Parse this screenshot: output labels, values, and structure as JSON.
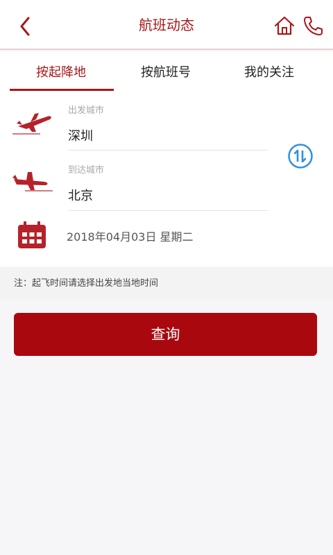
{
  "header": {
    "title": "航班动态",
    "back_icon": "chevron-left-icon",
    "home_icon": "home-icon",
    "phone_icon": "phone-icon",
    "accent_color": "#a8161a"
  },
  "tabs": [
    {
      "label": "按起降地",
      "active": true
    },
    {
      "label": "按航班号",
      "active": false
    },
    {
      "label": "我的关注",
      "active": false
    }
  ],
  "departure": {
    "label": "出发城市",
    "value": "深圳",
    "icon": "takeoff-plane-icon"
  },
  "arrival": {
    "label": "到达城市",
    "value": "北京",
    "icon": "landing-plane-icon"
  },
  "swap_icon": "swap-arrows-icon",
  "date": {
    "value": "2018年04月03日 星期二",
    "icon": "calendar-icon"
  },
  "note": "注：起飞时间请选择出发地当地时间",
  "query_button": {
    "label": "查询",
    "color": "#a8080e"
  }
}
